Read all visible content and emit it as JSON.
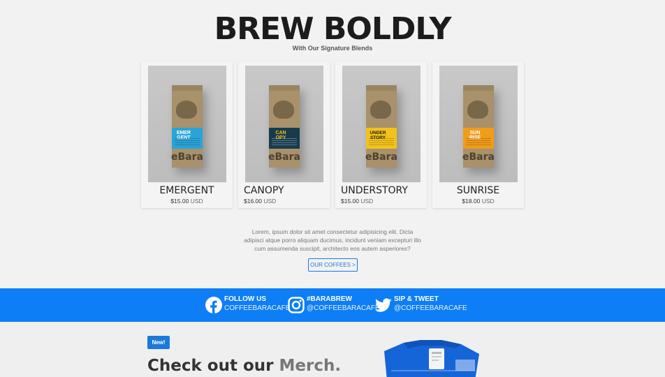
{
  "hero": {
    "title": "BREW BOLDLY",
    "subtitle": "With Our Signature Blends"
  },
  "products": [
    {
      "name": "EMERGENT",
      "price": "$15.00",
      "currency": "USD",
      "bag_label_line1": "EMER",
      "bag_label_line2": "GENT",
      "label_color": "#2aa3d6",
      "text_align": "center"
    },
    {
      "name": "CANOPY",
      "price": "$16.00",
      "currency": "USD",
      "bag_label_line1": "CAN",
      "bag_label_line2": "OPY",
      "label_color": "#173b4d",
      "label_text_color": "#f2c21b",
      "text_align": "left"
    },
    {
      "name": "UNDERSTORY",
      "price": "$15.00",
      "currency": "USD",
      "bag_label_line1": "UNDER",
      "bag_label_line2": "STORY",
      "label_color": "#f2c21b",
      "label_text_color": "#1d1d1d",
      "text_align": "left"
    },
    {
      "name": "SUNRISE",
      "price": "$18.00",
      "currency": "USD",
      "bag_label_line1": "SUN",
      "bag_label_line2": "RISE",
      "label_color": "#f19c1a",
      "text_align": "center"
    }
  ],
  "bag_brand": "eBara",
  "description": "Lorem, ipsum dolor sit amet consectetur adipisicing elit. Dicta adipisci atque porro aliquam ducimus, incidunt veniam excepturi illo cum assumenda suscipit, architecto eos autem asperiores?",
  "coffees_button": "OUR COFFEES >",
  "social": [
    {
      "icon": "facebook-icon",
      "title": "FOLLOW US",
      "handle": "COFFEEBARACAFE"
    },
    {
      "icon": "instagram-icon",
      "title": "#BARABREW",
      "handle": "@COFFEEBARACAFE"
    },
    {
      "icon": "twitter-icon",
      "title": "SIP & TWEET",
      "handle": "@COFFEEBARACAFE"
    }
  ],
  "merch": {
    "badge": "New!",
    "title_main": "Check out our ",
    "title_accent": "Merch."
  },
  "colors": {
    "accent": "#1a7ad9",
    "social_bar": "#0d7ef5"
  }
}
